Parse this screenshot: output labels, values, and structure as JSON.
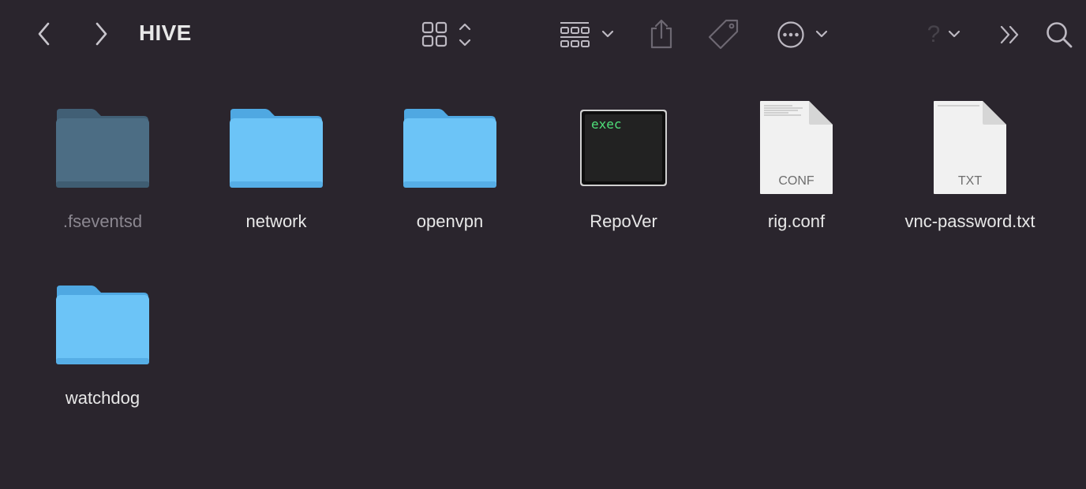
{
  "window": {
    "title": "HIVE"
  },
  "toolbar": {
    "back_icon": "chevron-left-icon",
    "forward_icon": "chevron-right-icon",
    "view_icon": "icon-grid-view-icon",
    "group_icon": "group-grid-icon",
    "share_icon": "share-icon",
    "tag_icon": "tag-icon",
    "more_icon": "ellipsis-circle-icon",
    "help_label": "?",
    "overflow_icon": "double-chevron-right-icon",
    "search_icon": "search-icon"
  },
  "items": [
    {
      "name": ".fseventsd",
      "kind": "folder",
      "hidden": true
    },
    {
      "name": "network",
      "kind": "folder"
    },
    {
      "name": "openvpn",
      "kind": "folder"
    },
    {
      "name": "RepoVer",
      "kind": "exec",
      "badge": "exec"
    },
    {
      "name": "rig.conf",
      "kind": "document",
      "ext": "CONF"
    },
    {
      "name": "vnc-password.txt",
      "kind": "document",
      "ext": "TXT"
    },
    {
      "name": "watchdog",
      "kind": "folder"
    }
  ],
  "colors": {
    "background": "#2a252d",
    "folder": "#6cc4f7",
    "folder_hidden": "#4c6d84"
  }
}
